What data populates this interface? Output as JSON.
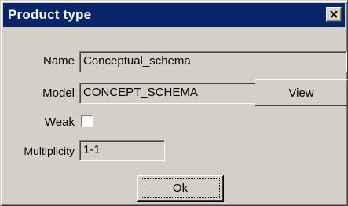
{
  "window": {
    "title": "Product type",
    "titlebar_color": "#0a246a",
    "face_color": "#d4d0c8",
    "close_icon": "close-icon"
  },
  "form": {
    "name_label": "Name",
    "name_value": "Conceptual_schema",
    "model_label": "Model",
    "model_value": "CONCEPT_SCHEMA",
    "view_button": "View",
    "weak_label": "Weak",
    "weak_checked": false,
    "multiplicity_label": "Multiplicity",
    "multiplicity_value": "1-1"
  },
  "actions": {
    "ok_label": "Ok"
  }
}
